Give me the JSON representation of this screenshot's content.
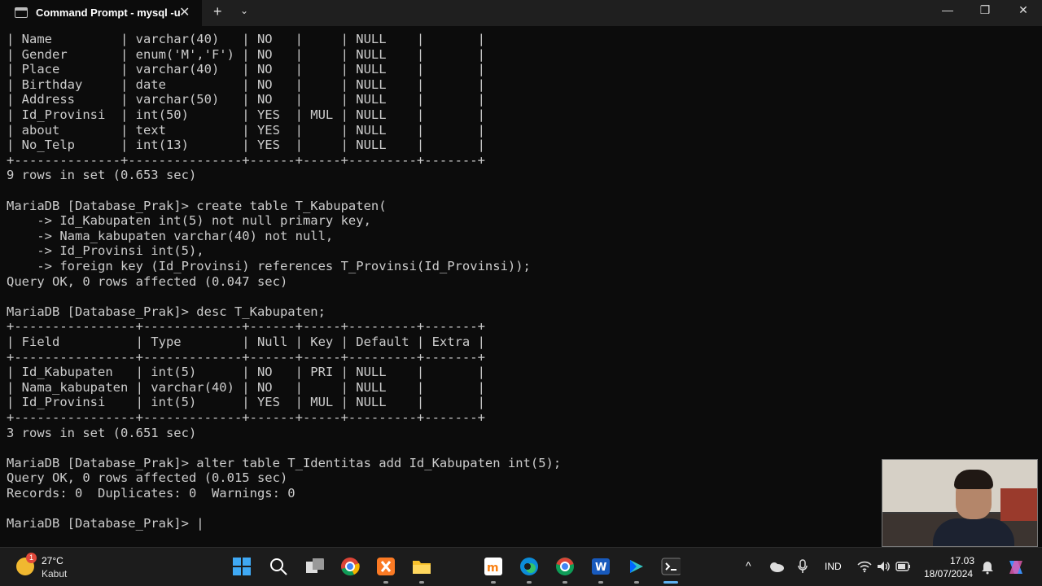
{
  "window": {
    "tab_title": "Command Prompt - mysql  -u",
    "tab_close": "✕",
    "new_tab": "+",
    "dropdown": "⌄",
    "minimize": "—",
    "maximize": "❐",
    "close": "✕"
  },
  "terminal": {
    "lines": [
      "| Name         | varchar(40)   | NO   |     | NULL    |       |",
      "| Gender       | enum('M','F') | NO   |     | NULL    |       |",
      "| Place        | varchar(40)   | NO   |     | NULL    |       |",
      "| Birthday     | date          | NO   |     | NULL    |       |",
      "| Address      | varchar(50)   | NO   |     | NULL    |       |",
      "| Id_Provinsi  | int(50)       | YES  | MUL | NULL    |       |",
      "| about        | text          | YES  |     | NULL    |       |",
      "| No_Telp      | int(13)       | YES  |     | NULL    |       |",
      "+--------------+---------------+------+-----+---------+-------+",
      "9 rows in set (0.653 sec)",
      "",
      "MariaDB [Database_Prak]> create table T_Kabupaten(",
      "    -> Id_Kabupaten int(5) not null primary key,",
      "    -> Nama_kabupaten varchar(40) not null,",
      "    -> Id_Provinsi int(5),",
      "    -> foreign key (Id_Provinsi) references T_Provinsi(Id_Provinsi));",
      "Query OK, 0 rows affected (0.047 sec)",
      "",
      "MariaDB [Database_Prak]> desc T_Kabupaten;",
      "+----------------+-------------+------+-----+---------+-------+",
      "| Field          | Type        | Null | Key | Default | Extra |",
      "+----------------+-------------+------+-----+---------+-------+",
      "| Id_Kabupaten   | int(5)      | NO   | PRI | NULL    |       |",
      "| Nama_kabupaten | varchar(40) | NO   |     | NULL    |       |",
      "| Id_Provinsi    | int(5)      | YES  | MUL | NULL    |       |",
      "+----------------+-------------+------+-----+---------+-------+",
      "3 rows in set (0.651 sec)",
      "",
      "MariaDB [Database_Prak]> alter table T_Identitas add Id_Kabupaten int(5);",
      "Query OK, 0 rows affected (0.015 sec)",
      "Records: 0  Duplicates: 0  Warnings: 0",
      "",
      "MariaDB [Database_Prak]> |"
    ]
  },
  "taskbar": {
    "weather_badge": "1",
    "temperature": "27°C",
    "condition": "Kabut",
    "pinned_apps": [
      "windows-start",
      "search",
      "task-view",
      "chrome",
      "xampp",
      "file-explorer",
      "moodle",
      "edge",
      "chrome-profile",
      "word",
      "power-automate",
      "terminal"
    ],
    "language": "IND",
    "time": "17.03",
    "date": "18/07/2024"
  }
}
